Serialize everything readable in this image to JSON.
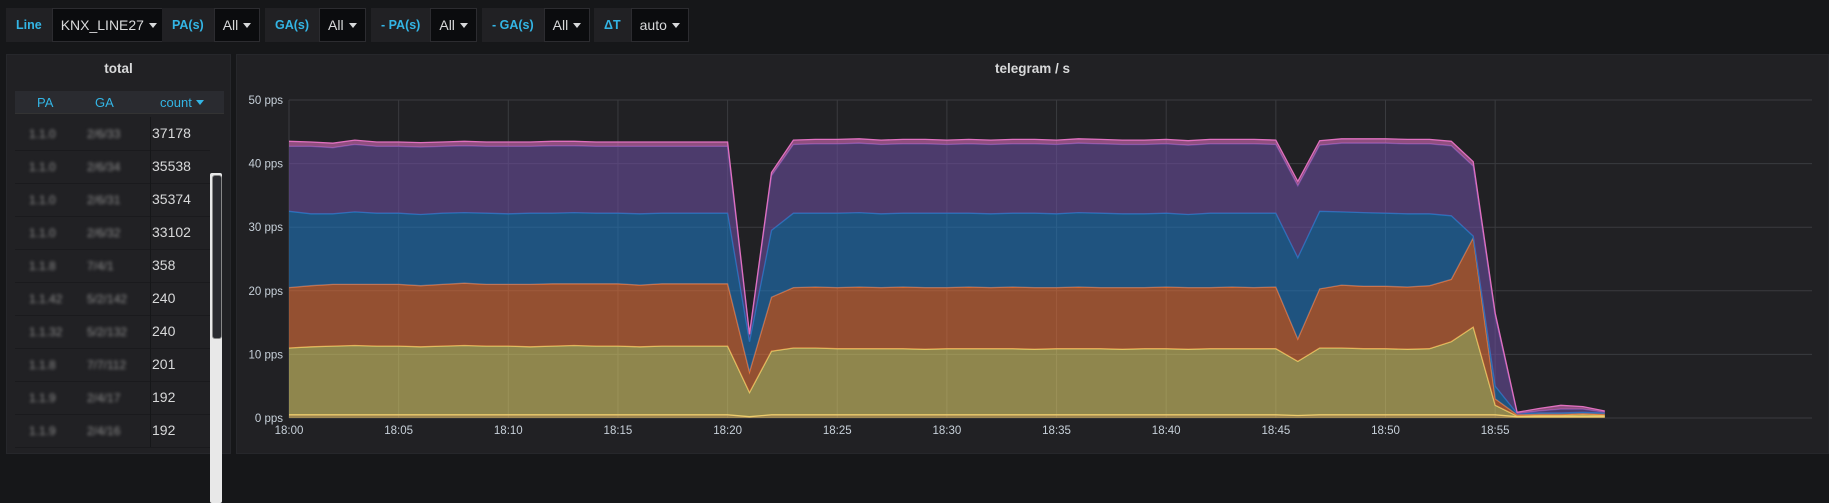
{
  "variables": [
    {
      "label": "Line",
      "value": "KNX_LINE27"
    },
    {
      "label": "PA(s)",
      "value": "All"
    },
    {
      "label": "GA(s)",
      "value": "All"
    },
    {
      "label": "- PA(s)",
      "value": "All"
    },
    {
      "label": "- GA(s)",
      "value": "All"
    },
    {
      "label": "ΔT",
      "value": "auto"
    }
  ],
  "table_panel": {
    "title": "total",
    "columns": [
      "PA",
      "GA",
      "count"
    ],
    "rows": [
      {
        "pa": "1.1.0",
        "ga": "2/6/33",
        "count": "37178"
      },
      {
        "pa": "1.1.0",
        "ga": "2/6/34",
        "count": "35538"
      },
      {
        "pa": "1.1.0",
        "ga": "2/6/31",
        "count": "35374"
      },
      {
        "pa": "1.1.0",
        "ga": "2/6/32",
        "count": "33102"
      },
      {
        "pa": "1.1.8",
        "ga": "7/4/1",
        "count": "358"
      },
      {
        "pa": "1.1.42",
        "ga": "5/2/142",
        "count": "240"
      },
      {
        "pa": "1.1.32",
        "ga": "5/2/132",
        "count": "240"
      },
      {
        "pa": "1.1.8",
        "ga": "7/7/112",
        "count": "201"
      },
      {
        "pa": "1.1.9",
        "ga": "2/4/17",
        "count": "192"
      },
      {
        "pa": "1.1.9",
        "ga": "2/4/16",
        "count": "192"
      }
    ]
  },
  "graph_panel": {
    "title": "telegram / s"
  },
  "chart_data": {
    "type": "area",
    "stacked": true,
    "title": "telegram / s",
    "x": [
      "18:00",
      "18:01",
      "18:02",
      "18:03",
      "18:04",
      "18:05",
      "18:06",
      "18:07",
      "18:08",
      "18:09",
      "18:10",
      "18:11",
      "18:12",
      "18:13",
      "18:14",
      "18:15",
      "18:16",
      "18:17",
      "18:18",
      "18:19",
      "18:20",
      "18:21",
      "18:22",
      "18:23",
      "18:24",
      "18:25",
      "18:26",
      "18:27",
      "18:28",
      "18:29",
      "18:30",
      "18:31",
      "18:32",
      "18:33",
      "18:34",
      "18:35",
      "18:36",
      "18:37",
      "18:38",
      "18:39",
      "18:40",
      "18:41",
      "18:42",
      "18:43",
      "18:44",
      "18:45",
      "18:46",
      "18:47",
      "18:48",
      "18:49",
      "18:50",
      "18:51",
      "18:52",
      "18:53",
      "18:54",
      "18:55",
      "18:56",
      "18:57",
      "18:58",
      "18:59",
      "19:00"
    ],
    "x_ticks": [
      "18:00",
      "18:05",
      "18:10",
      "18:15",
      "18:20",
      "18:25",
      "18:30",
      "18:35",
      "18:40",
      "18:45",
      "18:50",
      "18:55"
    ],
    "y_ticks": [
      "0 pps",
      "10 pps",
      "20 pps",
      "30 pps",
      "40 pps",
      "50 pps"
    ],
    "ylim": [
      0,
      50
    ],
    "grid": true,
    "series": [
      {
        "color": "#f2c96d",
        "values": [
          0.5,
          0.5,
          0.5,
          0.5,
          0.5,
          0.5,
          0.5,
          0.5,
          0.5,
          0.5,
          0.5,
          0.5,
          0.5,
          0.5,
          0.5,
          0.5,
          0.5,
          0.5,
          0.5,
          0.5,
          0.5,
          0.2,
          0.5,
          0.5,
          0.5,
          0.5,
          0.5,
          0.5,
          0.5,
          0.5,
          0.5,
          0.5,
          0.5,
          0.5,
          0.5,
          0.5,
          0.5,
          0.5,
          0.5,
          0.5,
          0.5,
          0.5,
          0.5,
          0.5,
          0.5,
          0.5,
          0.4,
          0.5,
          0.5,
          0.5,
          0.5,
          0.5,
          0.5,
          0.5,
          0.5,
          0.5,
          0.2,
          0.2,
          0.2,
          0.2,
          0.2
        ]
      },
      {
        "color": "#e0d06b",
        "values": [
          10.5,
          10.7,
          10.8,
          10.9,
          10.8,
          10.8,
          10.7,
          10.8,
          10.9,
          10.8,
          10.8,
          10.7,
          10.8,
          10.9,
          10.8,
          10.8,
          10.7,
          10.8,
          10.8,
          10.8,
          10.8,
          3.8,
          10.0,
          10.5,
          10.5,
          10.4,
          10.4,
          10.4,
          10.4,
          10.3,
          10.4,
          10.4,
          10.4,
          10.4,
          10.3,
          10.4,
          10.4,
          10.4,
          10.3,
          10.4,
          10.4,
          10.3,
          10.4,
          10.4,
          10.4,
          10.4,
          8.5,
          10.5,
          10.5,
          10.4,
          10.4,
          10.3,
          10.4,
          11.5,
          13.8,
          1.5,
          0.1,
          0.2,
          0.2,
          0.3,
          0.2
        ]
      },
      {
        "color": "#e8743b",
        "values": [
          9.5,
          9.6,
          9.7,
          9.6,
          9.7,
          9.7,
          9.6,
          9.7,
          9.8,
          9.7,
          9.7,
          9.8,
          9.8,
          9.7,
          9.8,
          9.8,
          9.7,
          9.8,
          9.8,
          9.8,
          9.8,
          3.2,
          8.5,
          9.5,
          9.6,
          9.6,
          9.7,
          9.6,
          9.7,
          9.7,
          9.6,
          9.7,
          9.6,
          9.7,
          9.7,
          9.6,
          9.7,
          9.6,
          9.7,
          9.6,
          9.7,
          9.7,
          9.6,
          9.7,
          9.6,
          9.7,
          3.5,
          9.3,
          9.9,
          9.8,
          9.8,
          9.8,
          9.9,
          9.8,
          14.0,
          1.0,
          0.2,
          0.2,
          0.2,
          0.2,
          0.2
        ]
      },
      {
        "color": "#1f78c1",
        "values": [
          12.0,
          11.3,
          11.1,
          11.4,
          11.2,
          11.2,
          11.2,
          11.2,
          11.1,
          11.2,
          11.1,
          11.2,
          11.1,
          11.2,
          11.1,
          11.1,
          11.2,
          11.1,
          11.1,
          11.1,
          11.1,
          4.8,
          10.5,
          11.7,
          11.6,
          11.7,
          11.7,
          11.6,
          11.6,
          11.7,
          11.7,
          11.6,
          11.6,
          11.6,
          11.7,
          11.6,
          11.7,
          11.7,
          11.6,
          11.6,
          11.6,
          11.5,
          11.7,
          11.6,
          11.7,
          11.6,
          12.8,
          12.2,
          11.5,
          11.6,
          11.5,
          11.5,
          11.3,
          10.0,
          0.3,
          2.0,
          0.2,
          0.2,
          0.2,
          0.2,
          0.2
        ]
      },
      {
        "color": "#6d4fa0",
        "values": [
          10.2,
          10.6,
          10.4,
          10.6,
          10.5,
          10.5,
          10.6,
          10.5,
          10.5,
          10.5,
          10.6,
          10.5,
          10.6,
          10.5,
          10.5,
          10.5,
          10.6,
          10.5,
          10.5,
          10.5,
          10.5,
          1.0,
          8.6,
          10.8,
          10.9,
          10.9,
          10.9,
          10.9,
          10.9,
          10.9,
          10.8,
          10.9,
          10.9,
          10.9,
          10.9,
          10.9,
          10.9,
          10.9,
          10.9,
          10.9,
          10.9,
          10.9,
          10.9,
          10.9,
          10.9,
          10.8,
          11.3,
          10.4,
          10.8,
          10.9,
          11.0,
          11.0,
          11.0,
          11.0,
          11.0,
          11.0,
          0.0,
          0.3,
          0.6,
          0.5,
          0.1
        ]
      },
      {
        "color": "#e070c0",
        "values": [
          0.8,
          0.7,
          0.7,
          0.7,
          0.7,
          0.7,
          0.7,
          0.7,
          0.7,
          0.7,
          0.7,
          0.7,
          0.7,
          0.7,
          0.7,
          0.7,
          0.7,
          0.7,
          0.7,
          0.7,
          0.7,
          0.2,
          0.5,
          0.7,
          0.7,
          0.7,
          0.7,
          0.7,
          0.7,
          0.7,
          0.7,
          0.7,
          0.7,
          0.7,
          0.7,
          0.7,
          0.7,
          0.7,
          0.7,
          0.7,
          0.7,
          0.7,
          0.7,
          0.7,
          0.7,
          0.7,
          0.7,
          0.7,
          0.7,
          0.7,
          0.7,
          0.7,
          0.7,
          0.7,
          0.7,
          0.5,
          0.2,
          0.4,
          0.6,
          0.4,
          0.2
        ]
      }
    ]
  }
}
